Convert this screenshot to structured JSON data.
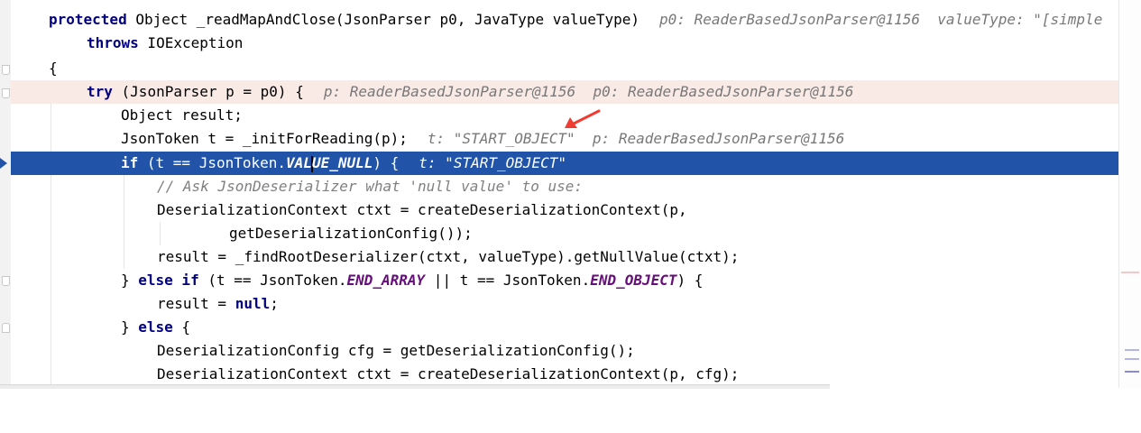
{
  "code": {
    "line1": {
      "kw": "protected",
      "text": " Object _readMapAndClose(JsonParser p0, JavaType valueType)",
      "hint": "p0: ReaderBasedJsonParser@1156  valueType: \"[simple"
    },
    "line2": {
      "kw": "throws",
      "text": " IOException"
    },
    "line3": {
      "text": "{"
    },
    "line4": {
      "kw": "try",
      "text": " (JsonParser p = p0) {",
      "hint": "p: ReaderBasedJsonParser@1156  p0: ReaderBasedJsonParser@1156"
    },
    "line5": {
      "text": "Object result;"
    },
    "line6": {
      "text": "JsonToken t = _initForReading(p);",
      "hint": "t: \"START_OBJECT\"  p: ReaderBasedJsonParser@1156"
    },
    "line7": {
      "kw": "if",
      "text_a": " (t == JsonToken.",
      "const_a": "VAL",
      "const_b": "UE_NULL",
      "text_b": ") {",
      "hint": "t: \"START_OBJECT\""
    },
    "line8": {
      "comment": "// Ask JsonDeserializer what 'null value' to use:"
    },
    "line9": {
      "text": "DeserializationContext ctxt = createDeserializationContext(p,"
    },
    "line10": {
      "text": "getDeserializationConfig());"
    },
    "line11": {
      "text": "result = _findRootDeserializer(ctxt, valueType).getNullValue(ctxt);"
    },
    "line12": {
      "text_a": "} ",
      "kw_a": "else if",
      "text_b": " (t == JsonToken.",
      "const_a": "END_ARRAY",
      "text_c": " || t == JsonToken.",
      "const_b": "END_OBJECT",
      "text_d": ") {"
    },
    "line13": {
      "text_a": "result = ",
      "kw": "null",
      "text_b": ";"
    },
    "line14": {
      "text_a": "} ",
      "kw": "else",
      "text_b": " {"
    },
    "line15": {
      "text": "DeserializationConfig cfg = getDeserializationConfig();"
    },
    "line16": {
      "text": "DeserializationContext ctxt = createDeserializationContext(p, cfg);"
    }
  },
  "colors": {
    "execution_line": "#2154a8",
    "breakpoint_line": "#faeae6",
    "keyword": "#000080",
    "constant": "#660e7a",
    "comment": "#808080",
    "inline_hint": "#787878",
    "annotation_arrow": "#f03c32"
  },
  "icons": [
    "fold-marker-icon",
    "execution-point-icon",
    "annotation-arrow-icon"
  ]
}
